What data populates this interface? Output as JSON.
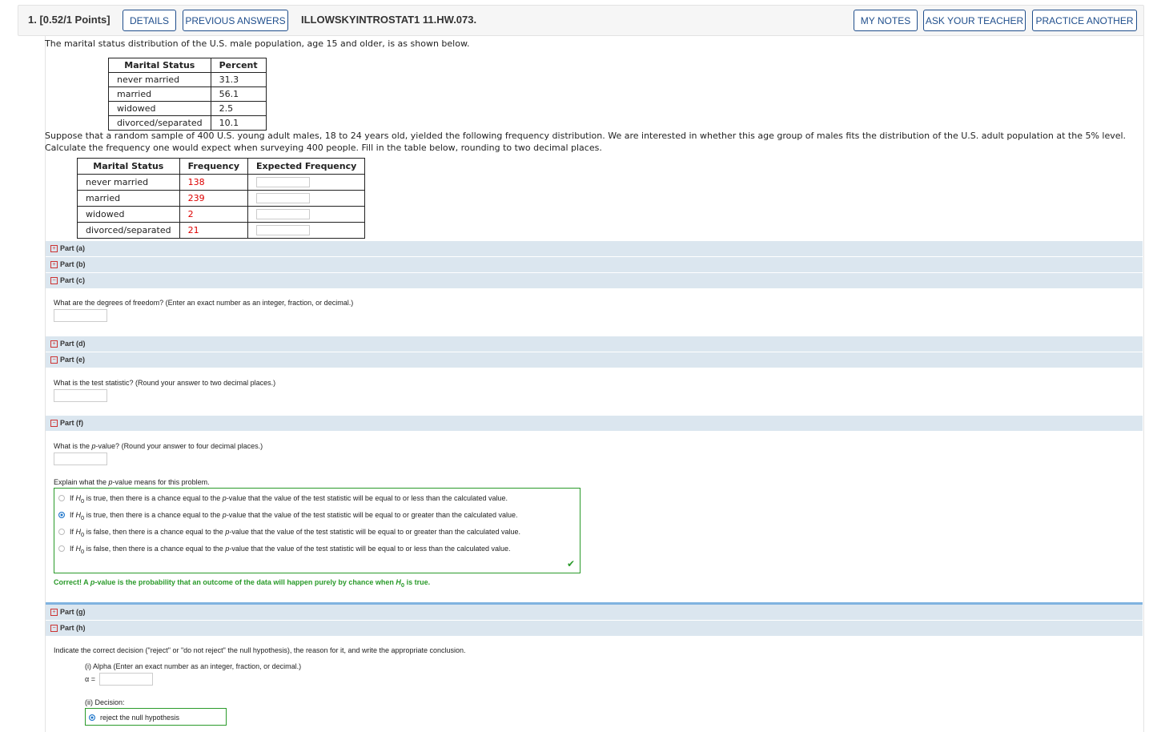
{
  "header": {
    "question_points": "1.  [0.52/1 Points]",
    "details": "DETAILS",
    "previous_answers": "PREVIOUS ANSWERS",
    "question_code": "ILLOWSKYINTROSTAT1 11.HW.073.",
    "my_notes": "MY NOTES",
    "ask_teacher": "ASK YOUR TEACHER",
    "practice_another": "PRACTICE ANOTHER"
  },
  "intro": "The marital status distribution of the U.S. male population, age 15 and older, is as shown below.",
  "table1": {
    "headers": [
      "Marital Status",
      "Percent"
    ],
    "rows": [
      [
        "never married",
        "31.3"
      ],
      [
        "married",
        "56.1"
      ],
      [
        "widowed",
        "2.5"
      ],
      [
        "divorced/separated",
        "10.1"
      ]
    ]
  },
  "problem": "Suppose that a random sample of 400 U.S. young adult males, 18 to 24 years old, yielded the following frequency distribution. We are interested in whether this age group of males fits the distribution of the U.S. adult population at the 5% level. Calculate the frequency one would expect when surveying 400 people. Fill in the table below, rounding to two decimal places.",
  "table2": {
    "headers": [
      "Marital Status",
      "Frequency",
      "Expected Frequency"
    ],
    "rows": [
      [
        "never married",
        "138"
      ],
      [
        "married",
        "239"
      ],
      [
        "widowed",
        "2"
      ],
      [
        "divorced/separated",
        "21"
      ]
    ]
  },
  "parts": {
    "a": "Part (a)",
    "b": "Part (b)",
    "c": "Part (c)",
    "d": "Part (d)",
    "e": "Part (e)",
    "f": "Part (f)",
    "g": "Part (g)",
    "h": "Part (h)"
  },
  "part_c_question": "What are the degrees of freedom? (Enter an exact number as an integer, fraction, or decimal.)",
  "part_e_question": "What is the test statistic? (Round your answer to two decimal places.)",
  "part_f": {
    "q1_before": "What is the ",
    "q1_p": "p",
    "q1_after": "-value? (Round your answer to four decimal places.)",
    "q2_before": "Explain what the ",
    "q2_p": "p",
    "q2_after": "-value means for this problem.",
    "options": [
      {
        "a": "If ",
        "h": "H",
        "sub": "0",
        "b": " is true, then there is a chance equal to the ",
        "p": "p",
        "c": "-value that the value of the test statistic will be equal to or less than the calculated value.",
        "selected": false
      },
      {
        "a": "If ",
        "h": "H",
        "sub": "0",
        "b": " is true, then there is a chance equal to the ",
        "p": "p",
        "c": "-value that the value of the test statistic will be equal to or greater than the calculated value.",
        "selected": true
      },
      {
        "a": "If ",
        "h": "H",
        "sub": "0",
        "b": " is false, then there is a chance equal to the ",
        "p": "p",
        "c": "-value that the value of the test statistic will be equal to or greater than the calculated value.",
        "selected": false
      },
      {
        "a": "If ",
        "h": "H",
        "sub": "0",
        "b": " is false, then there is a chance equal to the ",
        "p": "p",
        "c": "-value that the value of the test statistic will be equal to or less than the calculated value.",
        "selected": false
      }
    ],
    "feedback_a": "Correct! A ",
    "feedback_p": "p",
    "feedback_b": "-value is the probability that an outcome of the data will happen purely by chance when ",
    "feedback_h": "H",
    "feedback_sub": "0",
    "feedback_c": " is true."
  },
  "part_h": {
    "question": "Indicate the correct decision (\"reject\" or \"do not reject\" the null hypothesis), the reason for it, and write the appropriate conclusion.",
    "alpha_label": "(i) Alpha (Enter an exact number as an integer, fraction, or decimal.)",
    "alpha_symbol": "α =",
    "decision_label": "(ii) Decision:",
    "decision_option": "reject the null hypothesis"
  },
  "colors": {
    "accent": "#1f4e8c",
    "correct": "#2a9a2a",
    "part_bar": "#dbe6ef",
    "given_value": "#dd0000"
  }
}
